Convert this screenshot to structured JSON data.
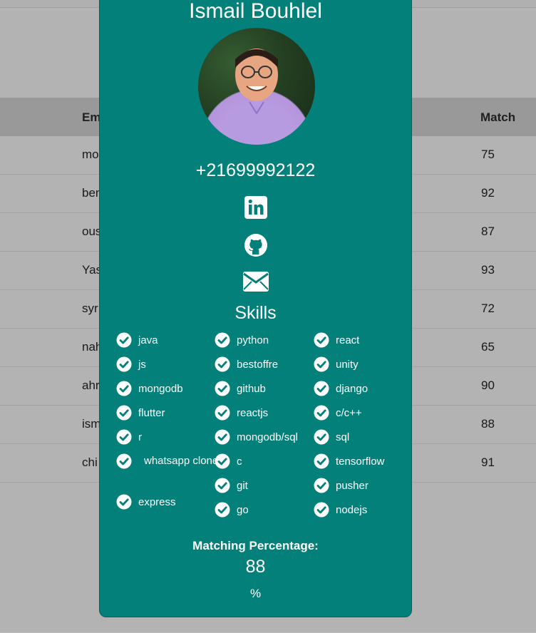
{
  "table": {
    "headers": {
      "email": "Em",
      "match": "Match"
    },
    "rows": [
      {
        "email": "mo",
        "match": "75"
      },
      {
        "email": "ben",
        "match": "92"
      },
      {
        "email": "ous",
        "match": "87"
      },
      {
        "email": "Yas",
        "match": "93"
      },
      {
        "email": "syr",
        "match": "72"
      },
      {
        "email": "nah",
        "match": "65"
      },
      {
        "email": "ahr",
        "match": "90"
      },
      {
        "email": "ism",
        "match": "88"
      },
      {
        "email": "chi",
        "match": "91"
      }
    ]
  },
  "profile": {
    "name": "Ismail Bouhlel",
    "phone": "+21699992122",
    "links": [
      "linkedin-icon",
      "github-icon",
      "envelope-icon"
    ]
  },
  "skills": {
    "title": "Skills",
    "col1": [
      "java",
      "js",
      "mongodb",
      "flutter",
      "r",
      "whatsapp clone",
      "express"
    ],
    "col2": [
      "python",
      "bestoffre",
      "github",
      "reactjs",
      "mongodb/sql",
      "c",
      "git",
      "go"
    ],
    "col3": [
      "react",
      "unity",
      "django",
      "c/c++",
      "sql",
      "tensorflow",
      "pusher",
      "nodejs"
    ]
  },
  "matching": {
    "label": "Matching Percentage:",
    "value": "88",
    "unit": "%"
  },
  "colors": {
    "modal_bg": "#038079",
    "overlay": "rgba(0,0,0,0.24)"
  }
}
